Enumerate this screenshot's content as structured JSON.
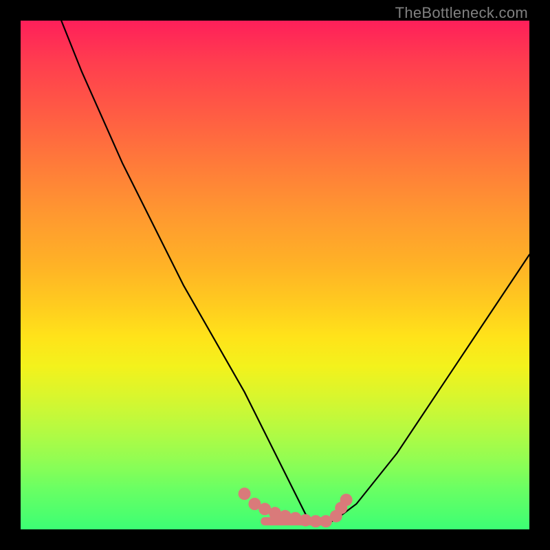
{
  "watermark": "TheBottleneck.com",
  "chart_data": {
    "type": "line",
    "title": "",
    "xlabel": "",
    "ylabel": "",
    "ylim": [
      0,
      100
    ],
    "xlim": [
      0,
      100
    ],
    "x": [
      8,
      12,
      16,
      20,
      24,
      28,
      32,
      36,
      40,
      44,
      46,
      48,
      50,
      52,
      54,
      56,
      58,
      60,
      62,
      66,
      70,
      74,
      78,
      82,
      86,
      90,
      94,
      98,
      100
    ],
    "values": [
      100,
      90,
      81,
      72,
      64,
      56,
      48,
      41,
      34,
      27,
      23,
      19,
      15,
      11,
      7,
      3,
      1,
      1,
      2,
      5,
      10,
      15,
      21,
      27,
      33,
      39,
      45,
      51,
      54
    ],
    "markers_x": [
      44,
      46,
      48,
      50,
      52,
      54,
      56,
      58,
      60,
      62,
      63,
      64
    ],
    "markers_y": [
      7,
      5,
      4,
      3.2,
      2.6,
      2.2,
      1.8,
      1.6,
      1.6,
      2.6,
      4.2,
      5.8
    ],
    "flat_segment": {
      "x0": 48,
      "x1": 60,
      "y": 1.6
    },
    "note": "Values are read off the plot relative to the plot area (0-100 each axis). Curve shows a V / valley shape with minimum near x≈58 reaching ~1, then rising more gently on the right. Salmon markers highlight the valley region."
  }
}
